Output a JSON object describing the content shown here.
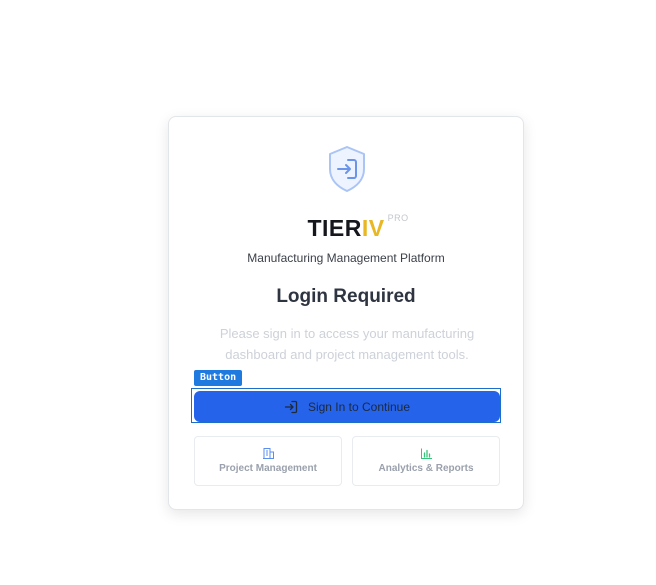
{
  "brand": {
    "name_main": "TIER",
    "name_accent": "IV",
    "badge": "PRO",
    "tagline": "Manufacturing Management Platform"
  },
  "login": {
    "heading": "Login Required",
    "description": "Please sign in to access your manufacturing dashboard and project management tools.",
    "button_tag": "Button",
    "button_label": "Sign In to Continue"
  },
  "features": [
    {
      "icon": "building-icon",
      "label": "Project Management"
    },
    {
      "icon": "bar-chart-icon",
      "label": "Analytics & Reports"
    }
  ],
  "colors": {
    "primary": "#2563eb",
    "accent": "#e8b723",
    "shield": "#93b4f2",
    "chart_icon": "#34c47a"
  }
}
